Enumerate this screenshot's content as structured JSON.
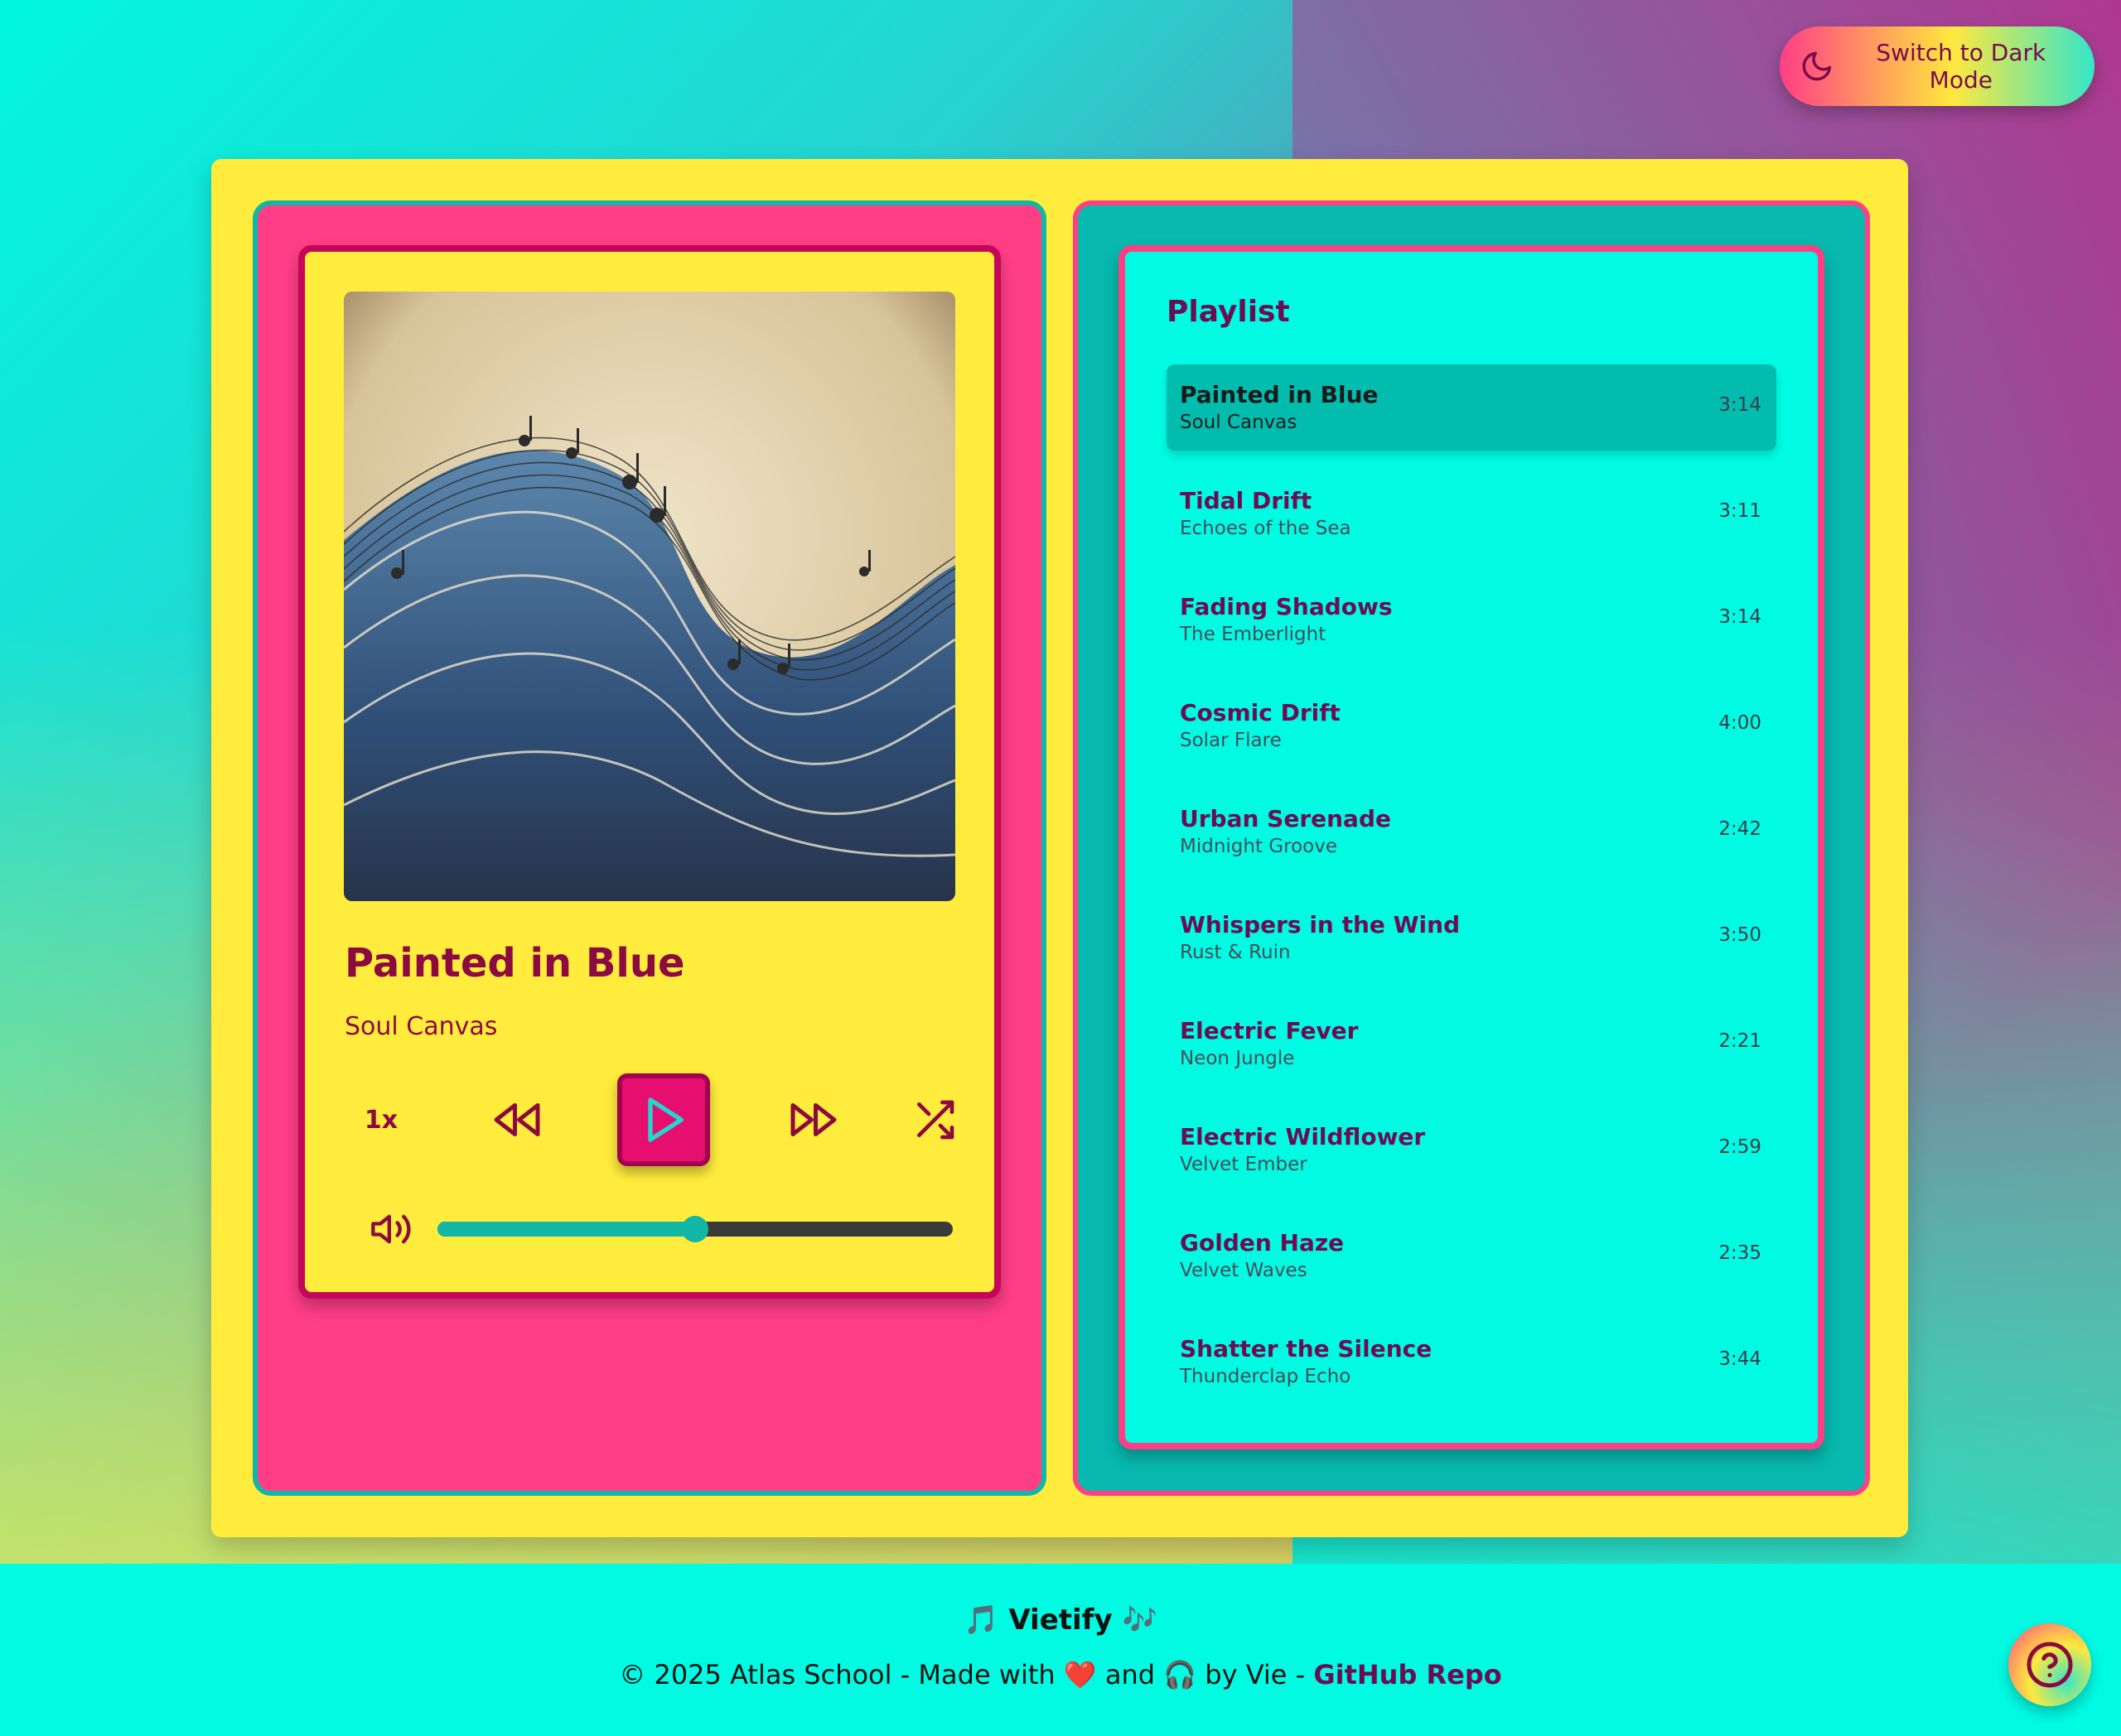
{
  "header": {
    "theme_toggle_label": "Switch to Dark Mode"
  },
  "player": {
    "title": "Painted in Blue",
    "artist": "Soul Canvas",
    "speed": "1x",
    "volume": 0.5,
    "icons": [
      "rewind-icon",
      "play-icon",
      "fast-forward-icon",
      "shuffle-icon",
      "volume-icon"
    ]
  },
  "playlist": {
    "heading": "Playlist",
    "items": [
      {
        "title": "Painted in Blue",
        "artist": "Soul Canvas",
        "duration": "3:14",
        "active": true
      },
      {
        "title": "Tidal Drift",
        "artist": "Echoes of the Sea",
        "duration": "3:11"
      },
      {
        "title": "Fading Shadows",
        "artist": "The Emberlight",
        "duration": "3:14"
      },
      {
        "title": "Cosmic Drift",
        "artist": "Solar Flare",
        "duration": "4:00"
      },
      {
        "title": "Urban Serenade",
        "artist": "Midnight Groove",
        "duration": "2:42"
      },
      {
        "title": "Whispers in the Wind",
        "artist": "Rust & Ruin",
        "duration": "3:50"
      },
      {
        "title": "Electric Fever",
        "artist": "Neon Jungle",
        "duration": "2:21"
      },
      {
        "title": "Electric Wildflower",
        "artist": "Velvet Ember",
        "duration": "2:59"
      },
      {
        "title": "Golden Haze",
        "artist": "Velvet Waves",
        "duration": "2:35"
      },
      {
        "title": "Shatter the Silence",
        "artist": "Thunderclap Echo",
        "duration": "3:44"
      }
    ]
  },
  "footer": {
    "brand": "🎵 Vietify 🎶",
    "copyright_prefix": "© 2025 Atlas School - Made with",
    "and": "and",
    "by": "by Vie -",
    "repo_link": "GitHub Repo"
  },
  "colors": {
    "accent_pink": "#ff3e86",
    "accent_yellow": "#ffec3d",
    "accent_teal": "#07b9ae",
    "accent_cyan": "#00fbe3",
    "text_maroon": "#8b0a3f"
  }
}
